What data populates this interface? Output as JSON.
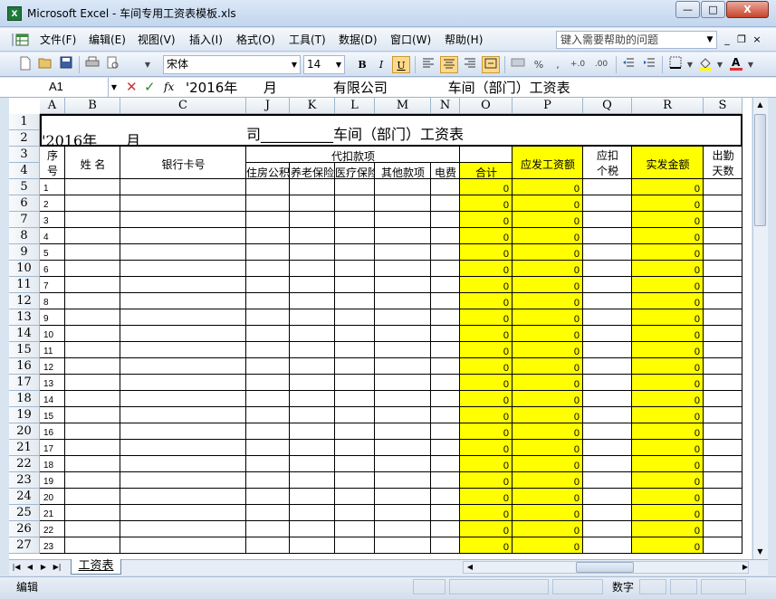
{
  "window": {
    "title": "Microsoft Excel - 车间专用工资表模板.xls",
    "app_icon": "X",
    "buttons": {
      "minimize": "—",
      "maximize": "□",
      "close": "X"
    }
  },
  "menu": {
    "items": [
      "文件(F)",
      "编辑(E)",
      "视图(V)",
      "插入(I)",
      "格式(O)",
      "工具(T)",
      "数据(D)",
      "窗口(W)",
      "帮助(H)"
    ],
    "help_placeholder": "键入需要帮助的问题",
    "doc_buttons": {
      "minimize": "_",
      "restore": "❐",
      "close": "×"
    }
  },
  "toolbar": {
    "font_name": "宋体",
    "font_size": "14",
    "bold": "B",
    "italic": "I",
    "underline": "U",
    "percent": "%",
    "comma": ","
  },
  "formula_bar": {
    "cell_ref": "A1",
    "cancel": "✕",
    "enter": "✓",
    "fx": "fx",
    "content": "'2016年      月             有限公司              车间（部门）工资表"
  },
  "grid": {
    "columns": [
      "A",
      "B",
      "C",
      "J",
      "K",
      "L",
      "M",
      "N",
      "O",
      "P",
      "Q",
      "R",
      "S"
    ],
    "title_left": "'2016年____月____________",
    "title_right": "司__________车间（部门）工资表",
    "headers": {
      "seq_top": "序",
      "seq_bottom": "号",
      "name": "姓 名",
      "bank_card": "银行卡号",
      "deductions_group": "代扣款项",
      "housing_fund": "住房公积",
      "pension": "养老保险",
      "medical": "医疗保险",
      "other": "其他款项",
      "electricity": "电费",
      "total": "合计",
      "gross_pay": "应发工资额",
      "tax_top": "应扣",
      "tax_bottom": "个税",
      "net_pay": "实发金额",
      "attendance_top": "出勤",
      "attendance_bottom": "天数"
    },
    "rows": [
      {
        "row": "1"
      },
      {
        "row": "2"
      },
      {
        "row": "3"
      },
      {
        "row": "4"
      },
      {
        "row": "5",
        "seq": "1",
        "o": "0",
        "p": "0",
        "r": "0"
      },
      {
        "row": "6",
        "seq": "2",
        "o": "0",
        "p": "0",
        "r": "0"
      },
      {
        "row": "7",
        "seq": "3",
        "o": "0",
        "p": "0",
        "r": "0"
      },
      {
        "row": "8",
        "seq": "4",
        "o": "0",
        "p": "0",
        "r": "0"
      },
      {
        "row": "9",
        "seq": "5",
        "o": "0",
        "p": "0",
        "r": "0"
      },
      {
        "row": "10",
        "seq": "6",
        "o": "0",
        "p": "0",
        "r": "0"
      },
      {
        "row": "11",
        "seq": "7",
        "o": "0",
        "p": "0",
        "r": "0"
      },
      {
        "row": "12",
        "seq": "8",
        "o": "0",
        "p": "0",
        "r": "0"
      },
      {
        "row": "13",
        "seq": "9",
        "o": "0",
        "p": "0",
        "r": "0"
      },
      {
        "row": "14",
        "seq": "10",
        "o": "0",
        "p": "0",
        "r": "0"
      },
      {
        "row": "15",
        "seq": "11",
        "o": "0",
        "p": "0",
        "r": "0"
      },
      {
        "row": "16",
        "seq": "12",
        "o": "0",
        "p": "0",
        "r": "0"
      },
      {
        "row": "17",
        "seq": "13",
        "o": "0",
        "p": "0",
        "r": "0"
      },
      {
        "row": "18",
        "seq": "14",
        "o": "0",
        "p": "0",
        "r": "0"
      },
      {
        "row": "19",
        "seq": "15",
        "o": "0",
        "p": "0",
        "r": "0"
      },
      {
        "row": "20",
        "seq": "16",
        "o": "0",
        "p": "0",
        "r": "0"
      },
      {
        "row": "21",
        "seq": "17",
        "o": "0",
        "p": "0",
        "r": "0"
      },
      {
        "row": "22",
        "seq": "18",
        "o": "0",
        "p": "0",
        "r": "0"
      },
      {
        "row": "23",
        "seq": "19",
        "o": "0",
        "p": "0",
        "r": "0"
      },
      {
        "row": "24",
        "seq": "20",
        "o": "0",
        "p": "0",
        "r": "0"
      },
      {
        "row": "25",
        "seq": "21",
        "o": "0",
        "p": "0",
        "r": "0"
      },
      {
        "row": "26",
        "seq": "22",
        "o": "0",
        "p": "0",
        "r": "0"
      },
      {
        "row": "27",
        "seq": "23",
        "o": "0",
        "p": "0",
        "r": "0"
      }
    ],
    "highlight_color": "#ffff00"
  },
  "sheet_tabs": [
    "工资表"
  ],
  "status": {
    "mode": "编辑",
    "num": "数字"
  }
}
